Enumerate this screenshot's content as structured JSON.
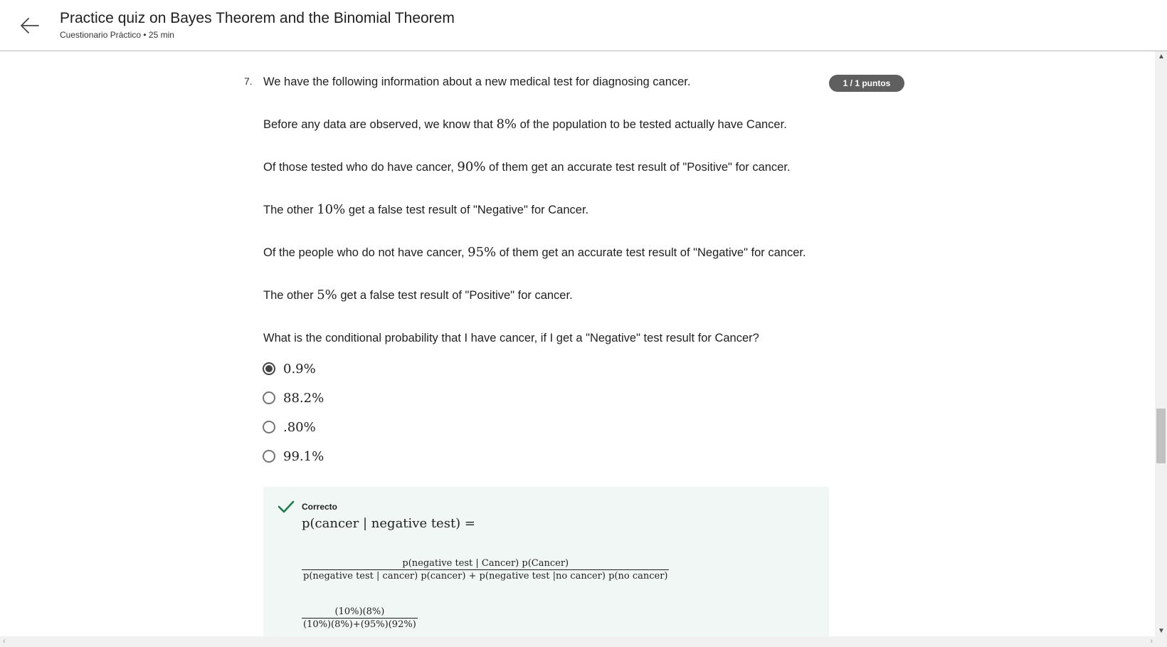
{
  "header": {
    "title": "Practice quiz on Bayes Theorem and the Binomial Theorem",
    "subtitle": "Cuestionario Práctico • 25 min",
    "back_icon": "arrow-left-icon"
  },
  "question": {
    "number": "7.",
    "intro": "We have the following information about a new medical test for diagnosing cancer.",
    "score_badge": "1 / 1 puntos",
    "p1": {
      "pre": "Before any data are observed, we know that ",
      "value": "8%",
      "post": " of the population to be tested actually have Cancer."
    },
    "p2": {
      "pre": "Of those tested who do have cancer, ",
      "value": "90%",
      "post": " of them get an accurate test result of \"Positive\" for cancer."
    },
    "p3": {
      "pre": "The other ",
      "value": "10%",
      "post": " get a false test result of \"Negative\" for Cancer."
    },
    "p4": {
      "pre": "Of the people who do not have cancer, ",
      "value": "95%",
      "post": " of them get an accurate test result of \"Negative\" for cancer."
    },
    "p5": {
      "pre": "The other ",
      "value": "5%",
      "post": " get a false test result of \"Positive\" for cancer."
    },
    "prompt": "What is the conditional probability that I have cancer, if I get a \"Negative\" test result for Cancer?",
    "options": [
      {
        "label": "0.9%",
        "selected": true
      },
      {
        "label": "88.2%",
        "selected": false
      },
      {
        "label": ".80%",
        "selected": false
      },
      {
        "label": "99.1%",
        "selected": false
      }
    ]
  },
  "feedback": {
    "status": "Correcto",
    "status_icon": "checkmark-icon",
    "eq1": "p(cancer | negative test) =",
    "frac1_num": "p(negative test | Cancer) p(Cancer)",
    "frac1_den": "p(negative test | cancer) p(cancer) + p(negative test |no cancer) p(no cancer)",
    "frac2_num": "(10%)(8%)",
    "frac2_den": "(10%)(8%)+(95%)(92%)"
  },
  "colors": {
    "badge_bg": "#5f5f5f",
    "feedback_bg": "#f0f7f4",
    "check_green": "#1e7b4c"
  }
}
